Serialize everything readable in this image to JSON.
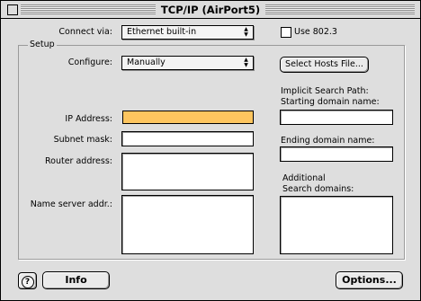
{
  "window": {
    "title": "TCP/IP (AirPort5)"
  },
  "connect": {
    "label": "Connect via:",
    "value": "Ethernet built-in",
    "use8023_label": "Use 802.3"
  },
  "setup": {
    "group_label": "Setup",
    "configure_label": "Configure:",
    "configure_value": "Manually",
    "select_hosts_label": "Select Hosts File...",
    "ip_label": "IP Address:",
    "ip_value": "",
    "subnet_label": "Subnet mask:",
    "subnet_value": "",
    "router_label": "Router address:",
    "router_value": "",
    "nameserver_label": "Name server addr.:",
    "nameserver_value": "",
    "implicit_label": "Implicit Search Path:",
    "starting_label": "Starting domain name:",
    "starting_value": "",
    "ending_label": "Ending domain name:",
    "ending_value": "",
    "additional_label_1": "Additional",
    "additional_label_2": "Search domains:",
    "additional_value": ""
  },
  "footer": {
    "help_label": "?",
    "info_label": "Info",
    "options_label": "Options..."
  },
  "colors": {
    "highlight": "#fdc55f",
    "window_bg": "#dedede"
  }
}
